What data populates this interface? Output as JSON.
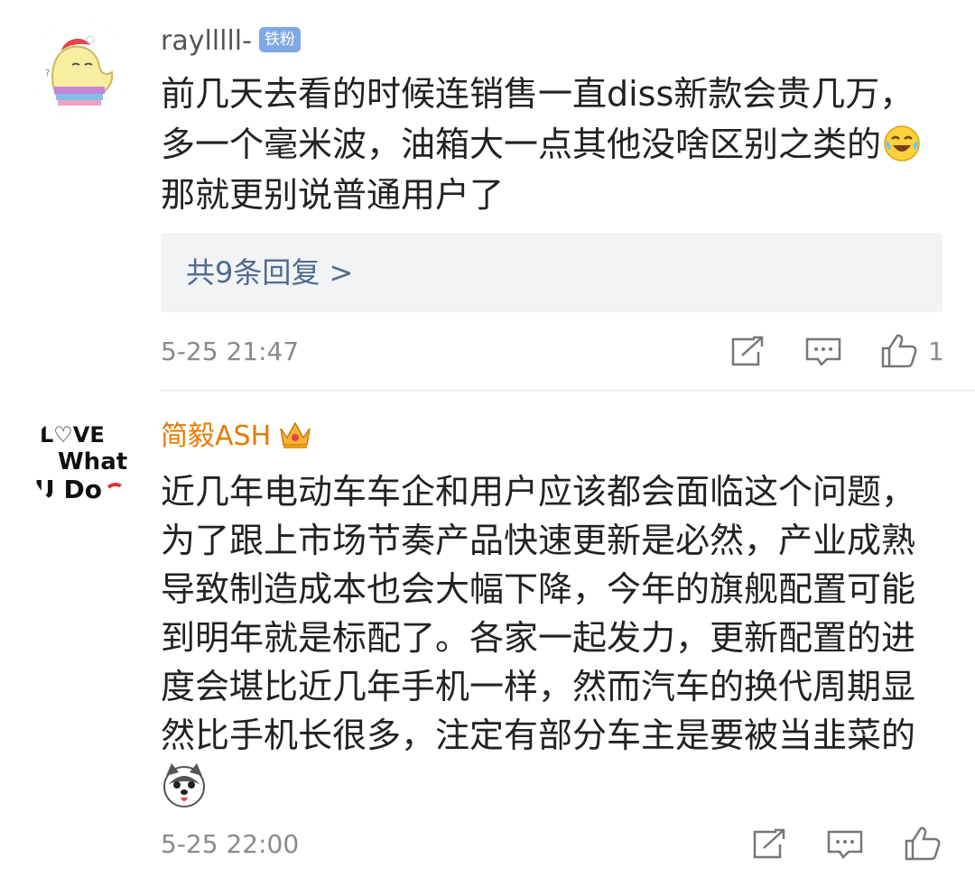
{
  "comments": [
    {
      "username": "raylllll-",
      "badge": "铁粉",
      "lines": [
        "前几天去看的时候连销售一直diss新款会贵几万，",
        "多一个毫米波，油箱大一点其他没啥区别之类的",
        "那就更别说普通用户了"
      ],
      "inline_emoji": "laughing-tears-emoji",
      "replies_label": "共9条回复 >",
      "time": "5-25 21:47",
      "like_count": "1"
    },
    {
      "username": "简毅ASH",
      "lines": [
        "近几年电动车车企和用户应该都会面临这个问题，",
        "为了跟上市场节奏产品快速更新是必然，产业成熟",
        "导致制造成本也会大幅下降，今年的旗舰配置可能",
        "到明年就是标配了。各家一起发力，更新配置的进",
        "度会堪比近几年手机一样，然而汽车的换代周期显",
        "然比手机长很多，注定有部分车主是要被当韭菜的"
      ],
      "inline_emoji": "husky-dog-emoji",
      "time": "5-25 22:00",
      "like_count": ""
    }
  ],
  "avatar_text": [
    "L♡VE",
    "What",
    "U Do"
  ],
  "icons": {
    "share": "share-icon",
    "comment": "comment-icon",
    "like": "thumbs-up-icon",
    "crown": "crown-badge-icon"
  },
  "colors": {
    "username_vip": "#e87a00",
    "username": "#555555",
    "link": "#4f6a92",
    "meta": "#8a8a8a",
    "badge_bg": "#7fa9e6",
    "reply_bg": "#f2f3f5"
  }
}
